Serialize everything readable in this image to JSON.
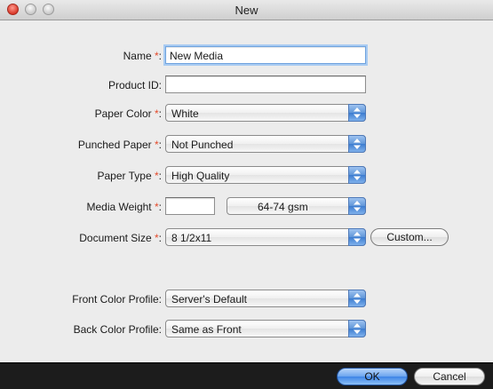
{
  "window": {
    "title": "New"
  },
  "form": {
    "name": {
      "label": "Name",
      "required_mark": "*",
      "colon": ":",
      "value": "New Media"
    },
    "product_id": {
      "label": "Product ID:",
      "value": ""
    },
    "paper_color": {
      "label": "Paper Color",
      "required_mark": "*",
      "colon": ":",
      "value": "White"
    },
    "punched_paper": {
      "label": "Punched Paper",
      "required_mark": "*",
      "colon": ":",
      "value": "Not Punched"
    },
    "paper_type": {
      "label": "Paper Type",
      "required_mark": "*",
      "colon": ":",
      "value": "High Quality"
    },
    "media_weight": {
      "label": "Media Weight",
      "required_mark": "*",
      "colon": ":",
      "value": "",
      "range": "64-74 gsm"
    },
    "document_size": {
      "label": "Document Size",
      "required_mark": "*",
      "colon": ":",
      "value": "8 1/2x11",
      "custom_button": "Custom..."
    },
    "front_color_profile": {
      "label": "Front Color Profile:",
      "value": "Server's Default"
    },
    "back_color_profile": {
      "label": "Back Color Profile:",
      "value": "Same as Front"
    }
  },
  "footer": {
    "ok_label": "OK",
    "cancel_label": "Cancel"
  },
  "colors": {
    "required": "#e34a2a",
    "focus": "#6fa3de",
    "default_button": "#3d84e6"
  }
}
